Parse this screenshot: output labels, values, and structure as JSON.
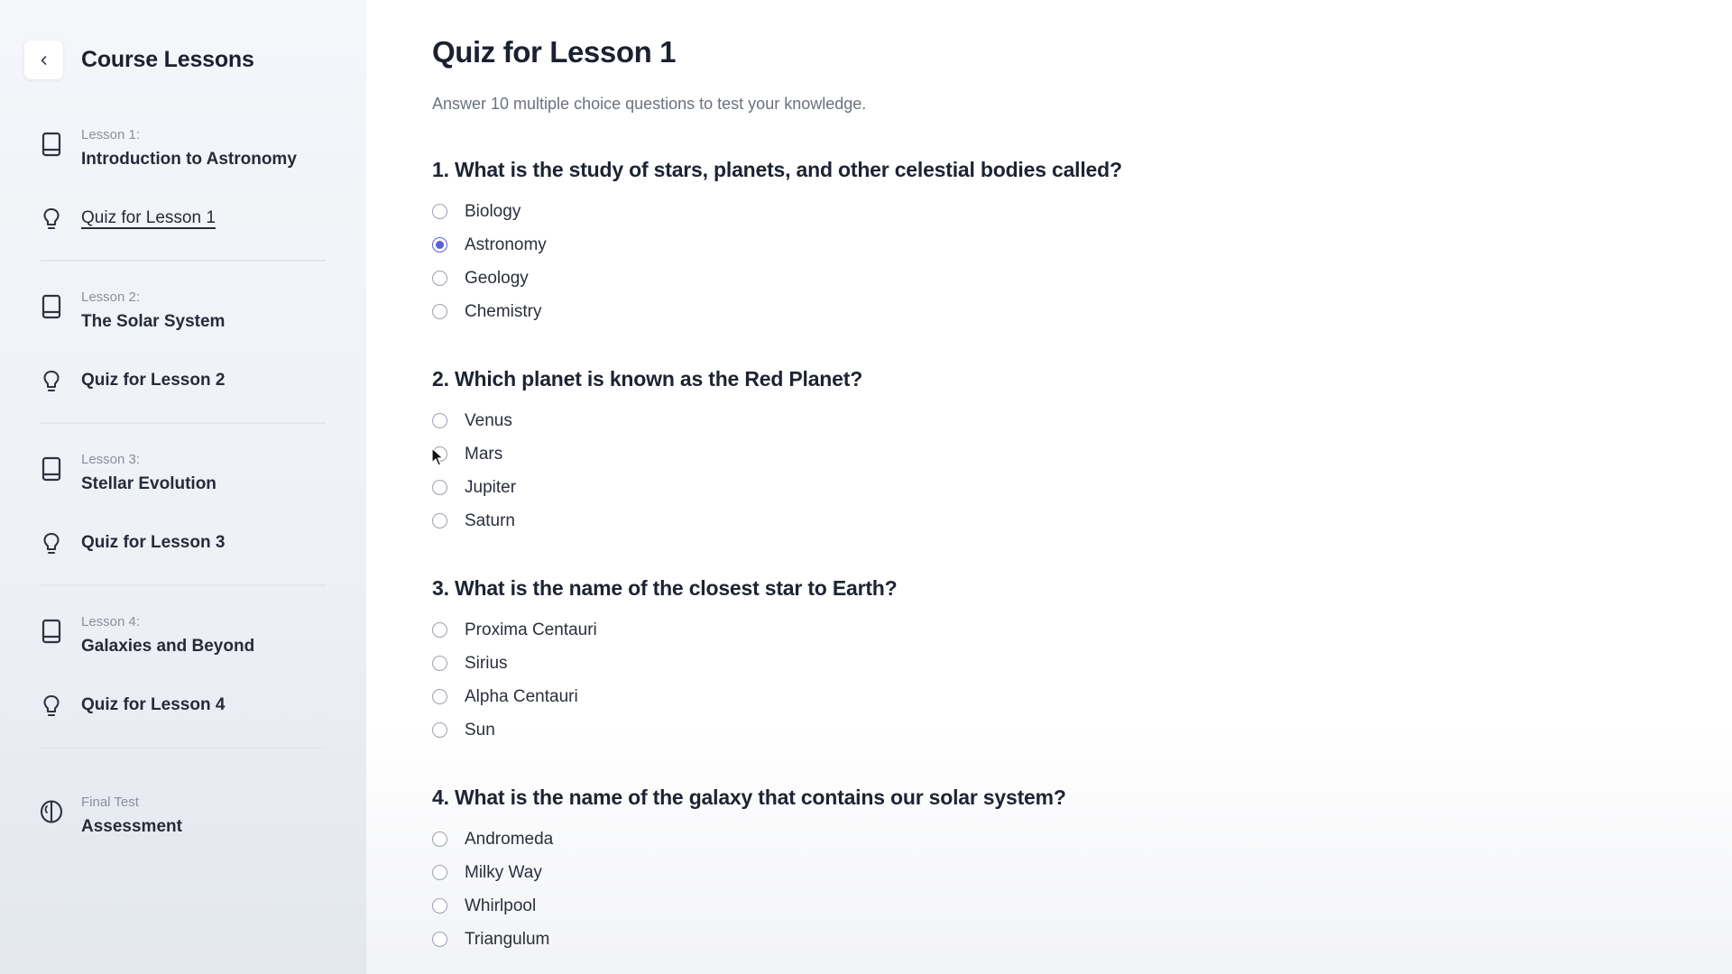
{
  "sidebar": {
    "title": "Course Lessons",
    "items": [
      {
        "kicker": "Lesson 1:",
        "label": "Introduction to Astronomy"
      },
      {
        "label": "Quiz for Lesson 1"
      },
      {
        "kicker": "Lesson 2:",
        "label": "The Solar System"
      },
      {
        "label": "Quiz for Lesson 2"
      },
      {
        "kicker": "Lesson 3:",
        "label": "Stellar Evolution"
      },
      {
        "label": "Quiz for Lesson 3"
      },
      {
        "kicker": "Lesson 4:",
        "label": "Galaxies and Beyond"
      },
      {
        "label": "Quiz for Lesson 4"
      },
      {
        "kicker": "Final Test",
        "label": "Assessment"
      }
    ],
    "active_item": "Quiz for Lesson 1"
  },
  "main": {
    "title": "Quiz for Lesson 1",
    "subtitle": "Answer 10 multiple choice questions to test your knowledge.",
    "questions": [
      {
        "text": "1. What is the study of stars, planets, and other celestial bodies called?",
        "options": [
          "Biology",
          "Astronomy",
          "Geology",
          "Chemistry"
        ],
        "selected": "Astronomy"
      },
      {
        "text": "2. Which planet is known as the Red Planet?",
        "options": [
          "Venus",
          "Mars",
          "Jupiter",
          "Saturn"
        ],
        "selected": null
      },
      {
        "text": "3. What is the name of the closest star to Earth?",
        "options": [
          "Proxima Centauri",
          "Sirius",
          "Alpha Centauri",
          "Sun"
        ],
        "selected": null
      },
      {
        "text": "4. What is the name of the galaxy that contains our solar system?",
        "options": [
          "Andromeda",
          "Milky Way",
          "Whirlpool",
          "Triangulum"
        ],
        "selected": null
      }
    ]
  },
  "colors": {
    "accent": "#5b5fd6",
    "sidebar_bg": "#f1f3f7",
    "text_primary": "#1c2030",
    "text_muted": "#6b7180"
  },
  "icons": {
    "back": "chevron-left-icon",
    "lesson": "book-icon",
    "quiz": "lightbulb-icon",
    "final": "brain-icon"
  }
}
